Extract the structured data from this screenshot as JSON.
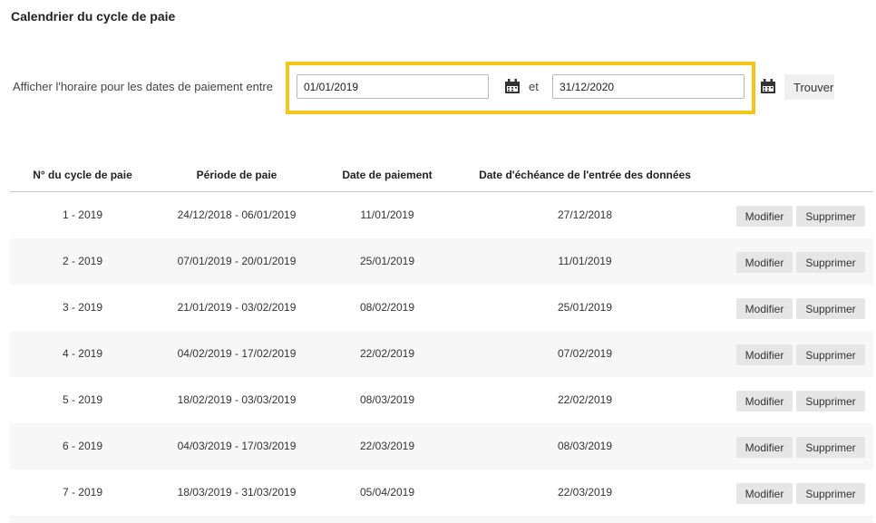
{
  "page_title": "Calendrier du cycle de paie",
  "filter": {
    "label": "Afficher l'horaire pour les dates de paiement entre",
    "date_from": "01/01/2019",
    "connector": "et",
    "date_to": "31/12/2020",
    "calendar_icon": "calendar-icon",
    "find_label": "Trouver",
    "highlight_color": "#f5c518"
  },
  "table": {
    "headers": [
      "N° du cycle de paie",
      "Période de paie",
      "Date de paiement",
      "Date d'échéance de l'entrée des données"
    ],
    "edit_label": "Modifier",
    "delete_label": "Supprimer",
    "rows": [
      {
        "cycle": "1 - 2019",
        "period": "24/12/2018 - 06/01/2019",
        "pay_date": "11/01/2019",
        "due_date": "27/12/2018"
      },
      {
        "cycle": "2 - 2019",
        "period": "07/01/2019 - 20/01/2019",
        "pay_date": "25/01/2019",
        "due_date": "11/01/2019"
      },
      {
        "cycle": "3 - 2019",
        "period": "21/01/2019 - 03/02/2019",
        "pay_date": "08/02/2019",
        "due_date": "25/01/2019"
      },
      {
        "cycle": "4 - 2019",
        "period": "04/02/2019 - 17/02/2019",
        "pay_date": "22/02/2019",
        "due_date": "07/02/2019"
      },
      {
        "cycle": "5 - 2019",
        "period": "18/02/2019 - 03/03/2019",
        "pay_date": "08/03/2019",
        "due_date": "22/02/2019"
      },
      {
        "cycle": "6 - 2019",
        "period": "04/03/2019 - 17/03/2019",
        "pay_date": "22/03/2019",
        "due_date": "08/03/2019"
      },
      {
        "cycle": "7 - 2019",
        "period": "18/03/2019 - 31/03/2019",
        "pay_date": "05/04/2019",
        "due_date": "22/03/2019"
      }
    ]
  }
}
